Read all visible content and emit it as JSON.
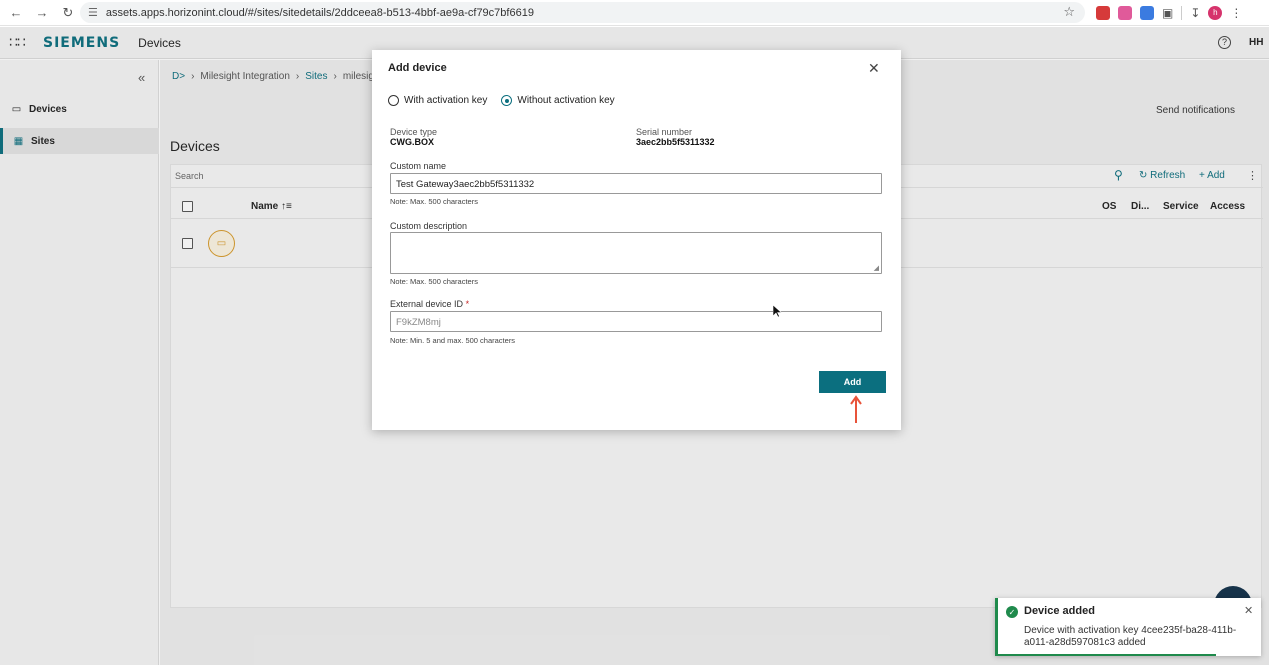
{
  "browser": {
    "url": "assets.apps.horizonint.cloud/#/sites/sitedetails/2ddceea8-b513-4bbf-ae9a-cf79c7bf6619",
    "profile_initial": "h"
  },
  "app": {
    "brand": "SIEMENS",
    "name": "Devices",
    "user_initials": "HH"
  },
  "sidebar": {
    "items": [
      {
        "label": "Devices",
        "icon": "device-icon"
      },
      {
        "label": "Sites",
        "icon": "building-icon"
      }
    ]
  },
  "breadcrumb": {
    "root_icon": "D>",
    "items": [
      "Milesight Integration",
      "Sites",
      "milesigh"
    ]
  },
  "header": {
    "send_notifications": "Send notifications",
    "page_title": "Devices"
  },
  "toolbar": {
    "search_placeholder": "Search",
    "refresh_label": "Refresh",
    "add_label": "+ Add"
  },
  "table": {
    "columns": [
      "Name ↑≡",
      "OS",
      "Di...",
      "Service",
      "Access"
    ]
  },
  "dialog": {
    "title": "Add device",
    "radio_options": [
      "With activation key",
      "Without activation key"
    ],
    "selected_radio": "Without activation key",
    "device_type_label": "Device type",
    "device_type_value": "CWG.BOX",
    "serial_label": "Serial number",
    "serial_value": "3aec2bb5f5311332",
    "custom_name_label": "Custom name",
    "custom_name_value": "Test Gateway3aec2bb5f5311332",
    "custom_name_note": "Note: Max. 500 characters",
    "custom_desc_label": "Custom description",
    "custom_desc_note": "Note: Max. 500 characters",
    "external_id_label": "External device ID",
    "external_id_required": "*",
    "external_id_placeholder": "F9kZM8mj",
    "external_id_note": "Note: Min. 5 and max. 500 characters",
    "add_button": "Add"
  },
  "toast": {
    "title": "Device added",
    "message": "Device with activation key 4cee235f-ba28-411b-a011-a28d597081c3 added"
  },
  "colors": {
    "accent": "#0b6f7f",
    "success": "#1f8a4c",
    "annotation_arrow": "#e8533a"
  }
}
